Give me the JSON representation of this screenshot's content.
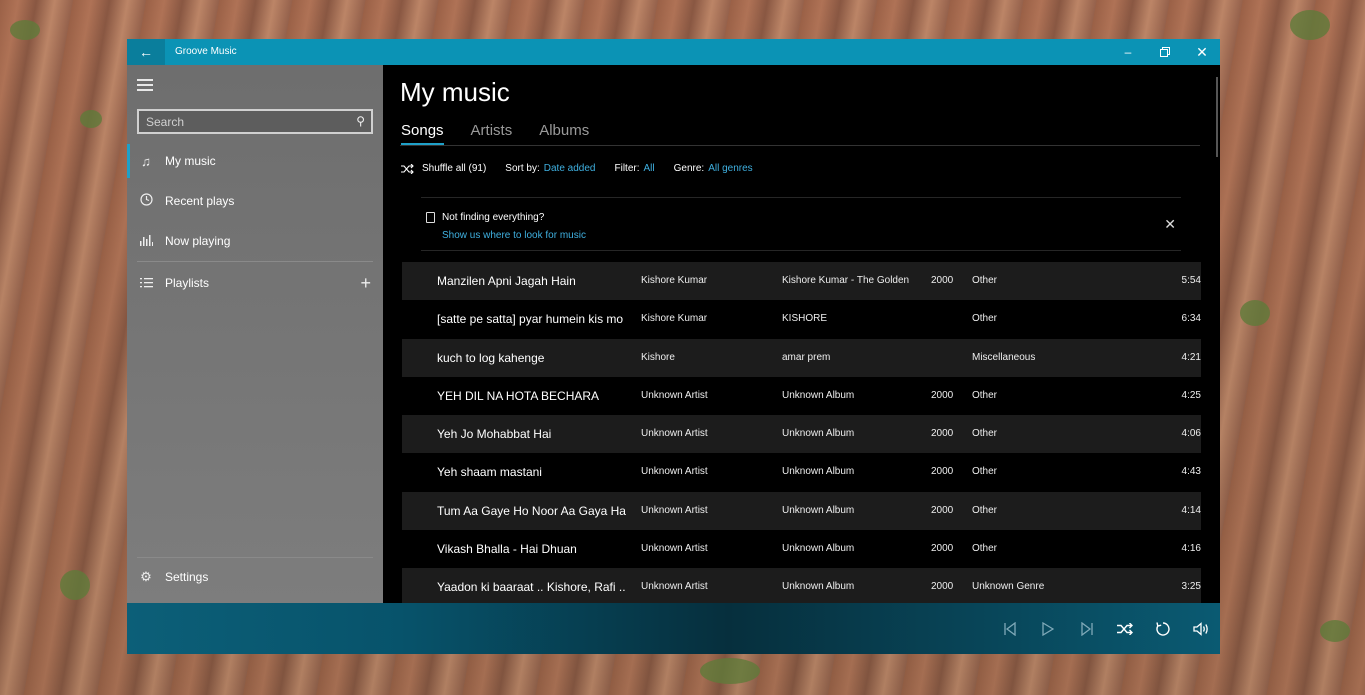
{
  "window": {
    "app_title": "Groove Music"
  },
  "sidebar": {
    "search_placeholder": "Search",
    "items": [
      {
        "label": "My music",
        "icon": "music-note-icon",
        "active": true
      },
      {
        "label": "Recent plays",
        "icon": "clock-icon",
        "active": false
      },
      {
        "label": "Now playing",
        "icon": "equalizer-icon",
        "active": false
      }
    ],
    "playlists_label": "Playlists",
    "settings_label": "Settings"
  },
  "main": {
    "title": "My music",
    "tabs": [
      {
        "label": "Songs",
        "active": true
      },
      {
        "label": "Artists",
        "active": false
      },
      {
        "label": "Albums",
        "active": false
      }
    ],
    "toolbar": {
      "shuffle_label": "Shuffle all (91)",
      "sort_label": "Sort by:",
      "sort_value": "Date added",
      "filter_label": "Filter:",
      "filter_value": "All",
      "genre_label": "Genre:",
      "genre_value": "All genres"
    },
    "notice": {
      "text": "Not finding everything?",
      "link": "Show us where to look for music"
    },
    "songs": [
      {
        "title": "Manzilen Apni Jagah Hain",
        "artist": "Kishore Kumar",
        "album": "Kishore Kumar - The Golden",
        "year": "2000",
        "genre": "Other",
        "duration": "5:54"
      },
      {
        "title": "[satte pe satta] pyar humein kis mo",
        "artist": "Kishore Kumar",
        "album": "KISHORE",
        "year": "",
        "genre": "Other",
        "duration": "6:34"
      },
      {
        "title": "kuch to log kahenge",
        "artist": "Kishore",
        "album": "amar prem",
        "year": "",
        "genre": "Miscellaneous",
        "duration": "4:21"
      },
      {
        "title": "YEH DIL NA HOTA BECHARA",
        "artist": "Unknown Artist",
        "album": "Unknown Album",
        "year": "2000",
        "genre": "Other",
        "duration": "4:25"
      },
      {
        "title": "Yeh Jo Mohabbat Hai",
        "artist": "Unknown Artist",
        "album": "Unknown Album",
        "year": "2000",
        "genre": "Other",
        "duration": "4:06"
      },
      {
        "title": "Yeh shaam mastani",
        "artist": "Unknown Artist",
        "album": "Unknown Album",
        "year": "2000",
        "genre": "Other",
        "duration": "4:43"
      },
      {
        "title": "Tum Aa Gaye Ho Noor Aa Gaya Ha",
        "artist": "Unknown Artist",
        "album": "Unknown Album",
        "year": "2000",
        "genre": "Other",
        "duration": "4:14"
      },
      {
        "title": "Vikash Bhalla  - Hai Dhuan",
        "artist": "Unknown Artist",
        "album": "Unknown Album",
        "year": "2000",
        "genre": "Other",
        "duration": "4:16"
      },
      {
        "title": "Yaadon ki baaraat .. Kishore, Rafi .. Y",
        "artist": "Unknown Artist",
        "album": "Unknown Album",
        "year": "2000",
        "genre": "Unknown Genre",
        "duration": "3:25"
      }
    ]
  },
  "player": {
    "controls": [
      "previous-icon",
      "play-icon",
      "next-icon",
      "shuffle-icon",
      "repeat-icon",
      "volume-icon"
    ]
  },
  "colors": {
    "accent": "#0b93b5",
    "link": "#3fb0e0"
  }
}
